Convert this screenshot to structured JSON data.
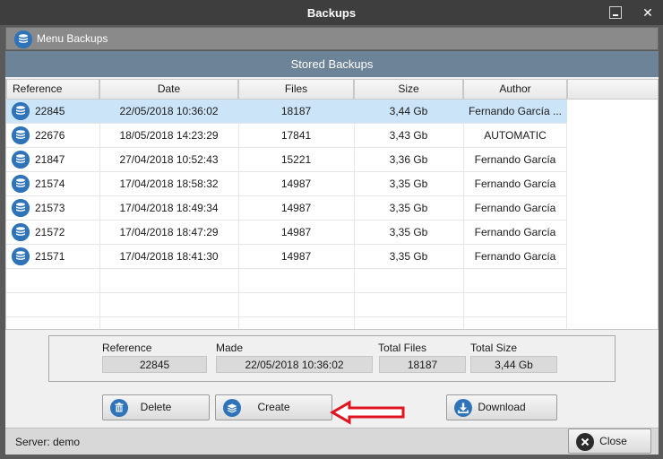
{
  "window": {
    "title": "Backups"
  },
  "header": {
    "menu_label": "Menu Backups",
    "stored_title": "Stored Backups"
  },
  "table": {
    "columns": [
      "Reference",
      "Date",
      "Files",
      "Size",
      "Author"
    ],
    "rows": [
      [
        "22845",
        "22/05/2018 10:36:02",
        "18187",
        "3,44 Gb",
        "Fernando García ..."
      ],
      [
        "22676",
        "18/05/2018 14:23:29",
        "17841",
        "3,43 Gb",
        "AUTOMATIC"
      ],
      [
        "21847",
        "27/04/2018 10:52:43",
        "15221",
        "3,36 Gb",
        "Fernando García"
      ],
      [
        "21574",
        "17/04/2018 18:58:32",
        "14987",
        "3,35 Gb",
        "Fernando García"
      ],
      [
        "21573",
        "17/04/2018 18:49:34",
        "14987",
        "3,35 Gb",
        "Fernando García"
      ],
      [
        "21572",
        "17/04/2018 18:47:29",
        "14987",
        "3,35 Gb",
        "Fernando García"
      ],
      [
        "21571",
        "17/04/2018 18:41:30",
        "14987",
        "3,35 Gb",
        "Fernando García"
      ]
    ],
    "selected_index": 0
  },
  "details": {
    "reference_label": "Reference",
    "reference_value": "22845",
    "made_label": "Made",
    "made_value": "22/05/2018 10:36:02",
    "total_files_label": "Total Files",
    "total_files_value": "18187",
    "total_size_label": "Total Size",
    "total_size_value": "3,44 Gb"
  },
  "buttons": {
    "delete": "Delete",
    "create": "Create",
    "download": "Download",
    "close": "Close"
  },
  "status": {
    "server": "Server: demo"
  },
  "colors": {
    "accent": "#2f74b8",
    "header_bar": "#6d8398",
    "selection": "#cce4f7",
    "arrow": "#e0141e"
  },
  "icons": [
    "database-icon",
    "trash-icon",
    "layers-icon",
    "download-icon",
    "close-circle-icon",
    "minimize-icon",
    "window-close-icon"
  ]
}
